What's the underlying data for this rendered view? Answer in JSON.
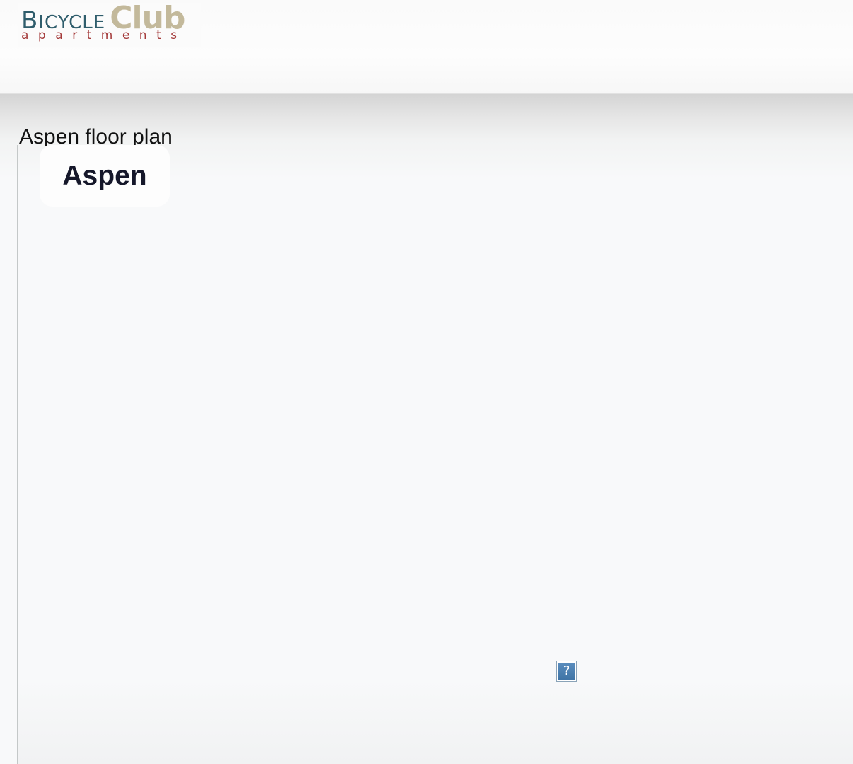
{
  "header": {
    "logo": {
      "word1_cap": "B",
      "word1_rest": "ICYCLE",
      "word2": "Club",
      "subtitle": "apartments",
      "colors": {
        "bicycle": "#2f5d6c",
        "club": "#c3b99b",
        "apartments": "#a43a3a"
      }
    }
  },
  "main": {
    "caption": "Aspen floor plan",
    "plan_title": "Aspen",
    "broken_image_icon": {
      "icon": "broken-image-icon",
      "glyph": "?"
    }
  }
}
